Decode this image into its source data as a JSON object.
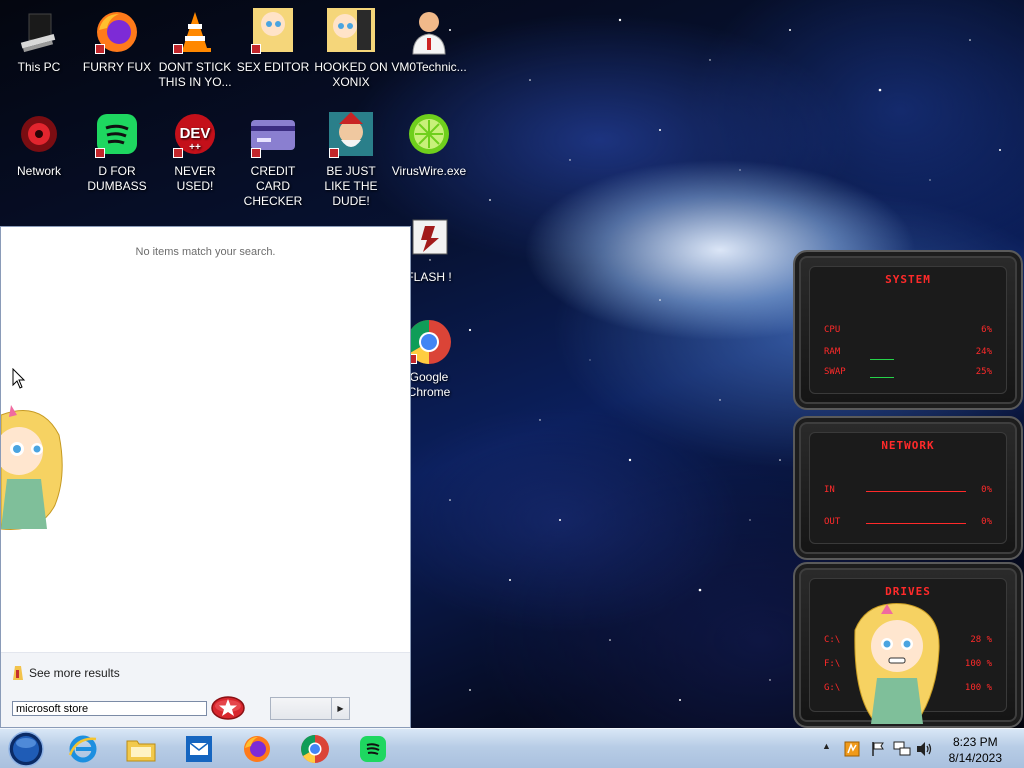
{
  "desktop": {
    "icons": [
      {
        "label": "This PC"
      },
      {
        "label": "FURRY FUX"
      },
      {
        "label": "DONT STICK THIS IN YO..."
      },
      {
        "label": "SEX EDITOR"
      },
      {
        "label": "HOOKED ON XONIX"
      },
      {
        "label": "VM0Technic..."
      },
      {
        "label": "Network"
      },
      {
        "label": "D FOR DUMBASS"
      },
      {
        "label": "NEVER USED!"
      },
      {
        "label": "CREDIT CARD CHECKER"
      },
      {
        "label": "BE JUST LIKE THE DUDE!"
      },
      {
        "label": "VirusWire.exe"
      },
      {
        "label": "FLASH !"
      },
      {
        "label": "Google Chrome"
      }
    ],
    "dev_icon_text": "DEV"
  },
  "start_menu": {
    "no_items_text": "No items match your search.",
    "see_more_label": "See more results",
    "search_value": "microsoft store"
  },
  "gadgets": {
    "system": {
      "title": "SYSTEM",
      "rows": [
        {
          "label": "CPU",
          "value": "6%"
        },
        {
          "label": "RAM",
          "value": "24%"
        },
        {
          "label": "SWAP",
          "value": "25%"
        }
      ]
    },
    "network": {
      "title": "NETWORK",
      "rows": [
        {
          "label": "IN",
          "value": "0%"
        },
        {
          "label": "OUT",
          "value": "0%"
        }
      ]
    },
    "drives": {
      "title": "DRIVES",
      "rows": [
        {
          "label": "C:\\",
          "value": "28 %"
        },
        {
          "label": "F:\\",
          "value": "100 %"
        },
        {
          "label": "G:\\",
          "value": "100 %"
        }
      ]
    }
  },
  "taskbar": {
    "apps": [
      "start-orb",
      "internet-explorer",
      "file-explorer",
      "mail",
      "firefox",
      "chrome",
      "spotify"
    ],
    "clock": {
      "time": "8:23 PM",
      "date": "8/14/2023"
    }
  },
  "colors": {
    "gadget_accent": "#ff2a2a",
    "taskbar": "#b8cde6",
    "start_menu_bg": "#ffffff"
  }
}
